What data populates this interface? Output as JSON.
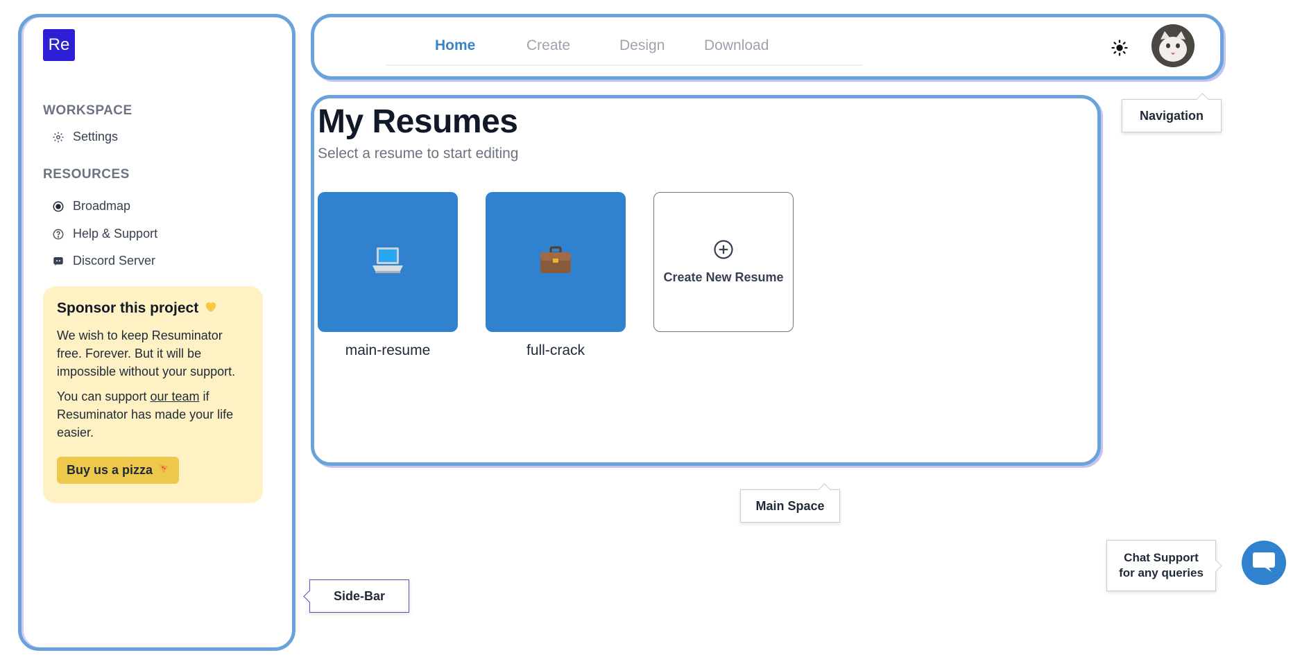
{
  "sidebar": {
    "logo": "Re",
    "workspace_heading": "WORKSPACE",
    "workspace_items": [
      {
        "label": "Settings",
        "icon": "gear-icon"
      }
    ],
    "resources_heading": "RESOURCES",
    "resources_items": [
      {
        "label": "Broadmap",
        "icon": "radio-target-icon"
      },
      {
        "label": "Help & Support",
        "icon": "question-circle-icon"
      },
      {
        "label": "Discord Server",
        "icon": "discord-icon"
      }
    ],
    "sponsor": {
      "title": "Sponsor this project",
      "title_icon": "yellow-heart-icon",
      "paragraph1": "We wish to keep Resuminator free. Forever. But it will be impossible without your support.",
      "paragraph2_before": "You can support ",
      "paragraph2_link": "our team",
      "paragraph2_after": " if Resuminator has made your life easier.",
      "button_label": "Buy us a pizza",
      "button_icon": "pizza-icon"
    }
  },
  "topnav": {
    "tabs": [
      {
        "label": "Home",
        "active": true
      },
      {
        "label": "Create",
        "active": false
      },
      {
        "label": "Design",
        "active": false
      },
      {
        "label": "Download",
        "active": false
      }
    ],
    "theme_icon": "sun-icon",
    "avatar_icon": "avatar-cat"
  },
  "main": {
    "title": "My Resumes",
    "subtitle": "Select a resume to start editing",
    "resumes": [
      {
        "name": "main-resume",
        "icon": "laptop-icon"
      },
      {
        "name": "full-crack",
        "icon": "briefcase-icon"
      }
    ],
    "create_label": "Create New Resume",
    "create_icon": "plus-circle-icon"
  },
  "tooltips": {
    "navigation": "Navigation",
    "main_space": "Main Space",
    "side_bar": "Side-Bar",
    "chat_line1": "Chat Support",
    "chat_line2": "for any queries"
  },
  "colors": {
    "accent": "#3182ce",
    "logo_bg": "#2d1fd6",
    "frame_border": "#6aa2dc",
    "sponsor_bg": "#fef2c4",
    "pizza_button": "#eec84b"
  }
}
